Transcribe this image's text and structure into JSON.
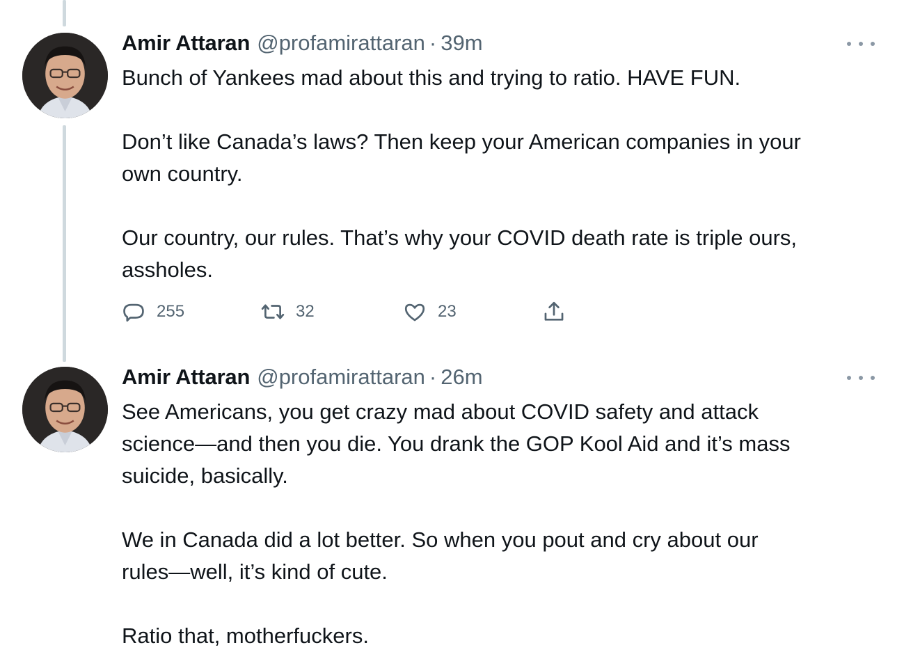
{
  "tweets": [
    {
      "author": {
        "display_name": "Amir Attaran",
        "handle": "@profamirattaran"
      },
      "separator": "·",
      "time": "39m",
      "paragraphs": [
        "Bunch of Yankees mad about this and trying to ratio.  HAVE FUN.",
        "",
        "Don’t like Canada’s laws?  Then keep your American companies in your",
        "own country.",
        "",
        "Our country, our rules.  That’s why your COVID death rate is triple ours,",
        "assholes."
      ],
      "stats": {
        "replies": "255",
        "retweets": "32",
        "likes": "23"
      },
      "icons": {
        "reply": "reply-icon",
        "retweet": "retweet-icon",
        "like": "heart-icon",
        "share": "share-icon",
        "more": "more-icon"
      }
    },
    {
      "author": {
        "display_name": "Amir Attaran",
        "handle": "@profamirattaran"
      },
      "separator": "·",
      "time": "26m",
      "paragraphs": [
        "See Americans, you get crazy mad about COVID safety and attack",
        "science—and then you die. You drank the GOP Kool Aid and it’s mass",
        "suicide, basically.",
        "",
        "We in Canada did a lot better. So when you pout and cry about our",
        "rules—well, it’s kind of cute.",
        "",
        "Ratio that, motherfuckers."
      ]
    }
  ],
  "colors": {
    "text": "#0f1419",
    "secondary": "#536471",
    "thread_line": "#cfd9de"
  }
}
